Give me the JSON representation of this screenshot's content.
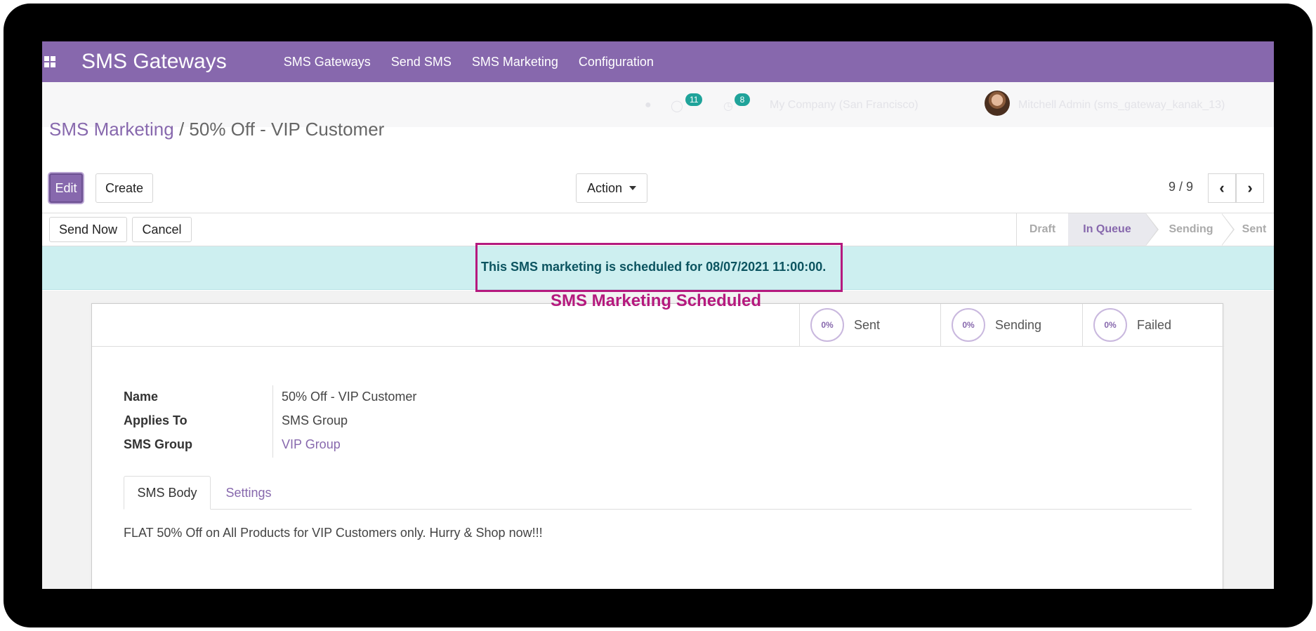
{
  "app": {
    "title": "SMS Gateways",
    "nav": [
      "SMS Gateways",
      "Send SMS",
      "SMS Marketing",
      "Configuration"
    ]
  },
  "systray": {
    "chat_count": "11",
    "activity_count": "8",
    "company": "My Company (San Francisco)",
    "user": "Mitchell Admin (sms_gateway_kanak_13)"
  },
  "breadcrumb": {
    "parent": "SMS Marketing",
    "separator": " / ",
    "current": "50% Off - VIP Customer"
  },
  "controls": {
    "edit": "Edit",
    "create": "Create",
    "action": "Action",
    "pager": "9 / 9"
  },
  "statusbar": {
    "send_now": "Send Now",
    "cancel": "Cancel",
    "stages": [
      "Draft",
      "In Queue",
      "Sending",
      "Sent"
    ],
    "active_stage": "In Queue"
  },
  "alert": {
    "text": "This SMS marketing is scheduled for 08/07/2021 11:00:00."
  },
  "annotation": "SMS Marketing Scheduled",
  "stats": [
    {
      "percent": "0%",
      "label": "Sent"
    },
    {
      "percent": "0%",
      "label": "Sending"
    },
    {
      "percent": "0%",
      "label": "Failed"
    }
  ],
  "fields": {
    "name_label": "Name",
    "name_value": "50% Off - VIP Customer",
    "applies_label": "Applies To",
    "applies_value": "SMS Group",
    "group_label": "SMS Group",
    "group_value": "VIP Group"
  },
  "tabs": [
    "SMS Body",
    "Settings"
  ],
  "sms_body": "FLAT 50% Off on All Products for VIP Customers only. Hurry & Shop now!!!",
  "colors": {
    "brand": "#8768ad",
    "alert_bg": "#cdeff0",
    "alert_text": "#0c5460",
    "annotation": "#b5197e"
  }
}
